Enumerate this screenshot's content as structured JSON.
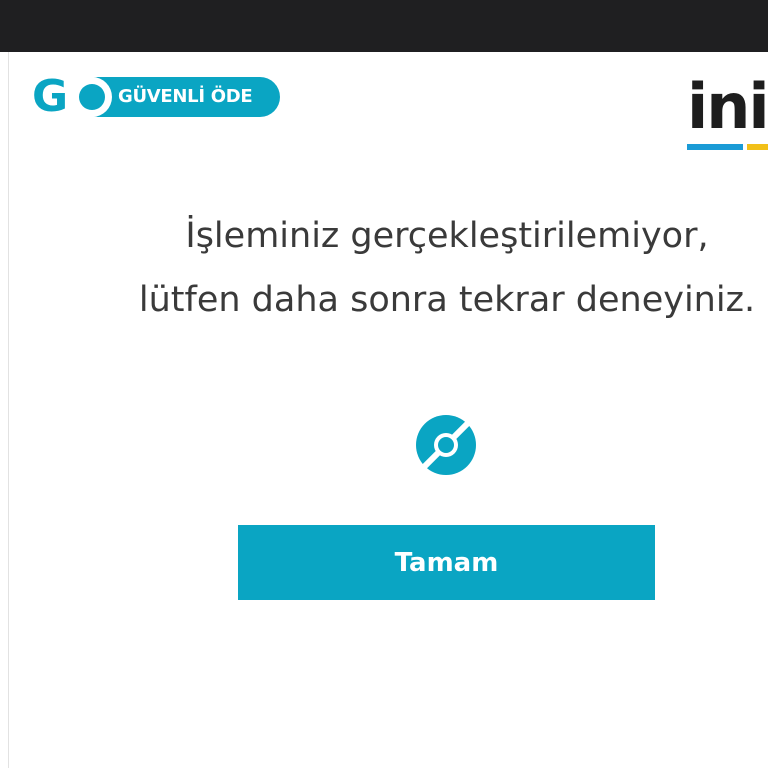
{
  "header": {
    "badge_logo": "GO",
    "badge_text": "GÜVENLİ ÖDE",
    "brand_logo": "ini"
  },
  "dialog": {
    "message_line1": "İşleminiz gerçekleştirilemiyor,",
    "message_line2": "lütfen daha sonra tekrar deneyiniz.",
    "ok_button_label": "Tamam"
  },
  "icons": {
    "spinner": "loading-spinner-icon"
  },
  "colors": {
    "accent": "#0aa5c3",
    "top_bar": "#1f1f21",
    "text": "#3a3a3a",
    "brand_blue": "#1a9bd6",
    "brand_yellow": "#f2c018"
  }
}
